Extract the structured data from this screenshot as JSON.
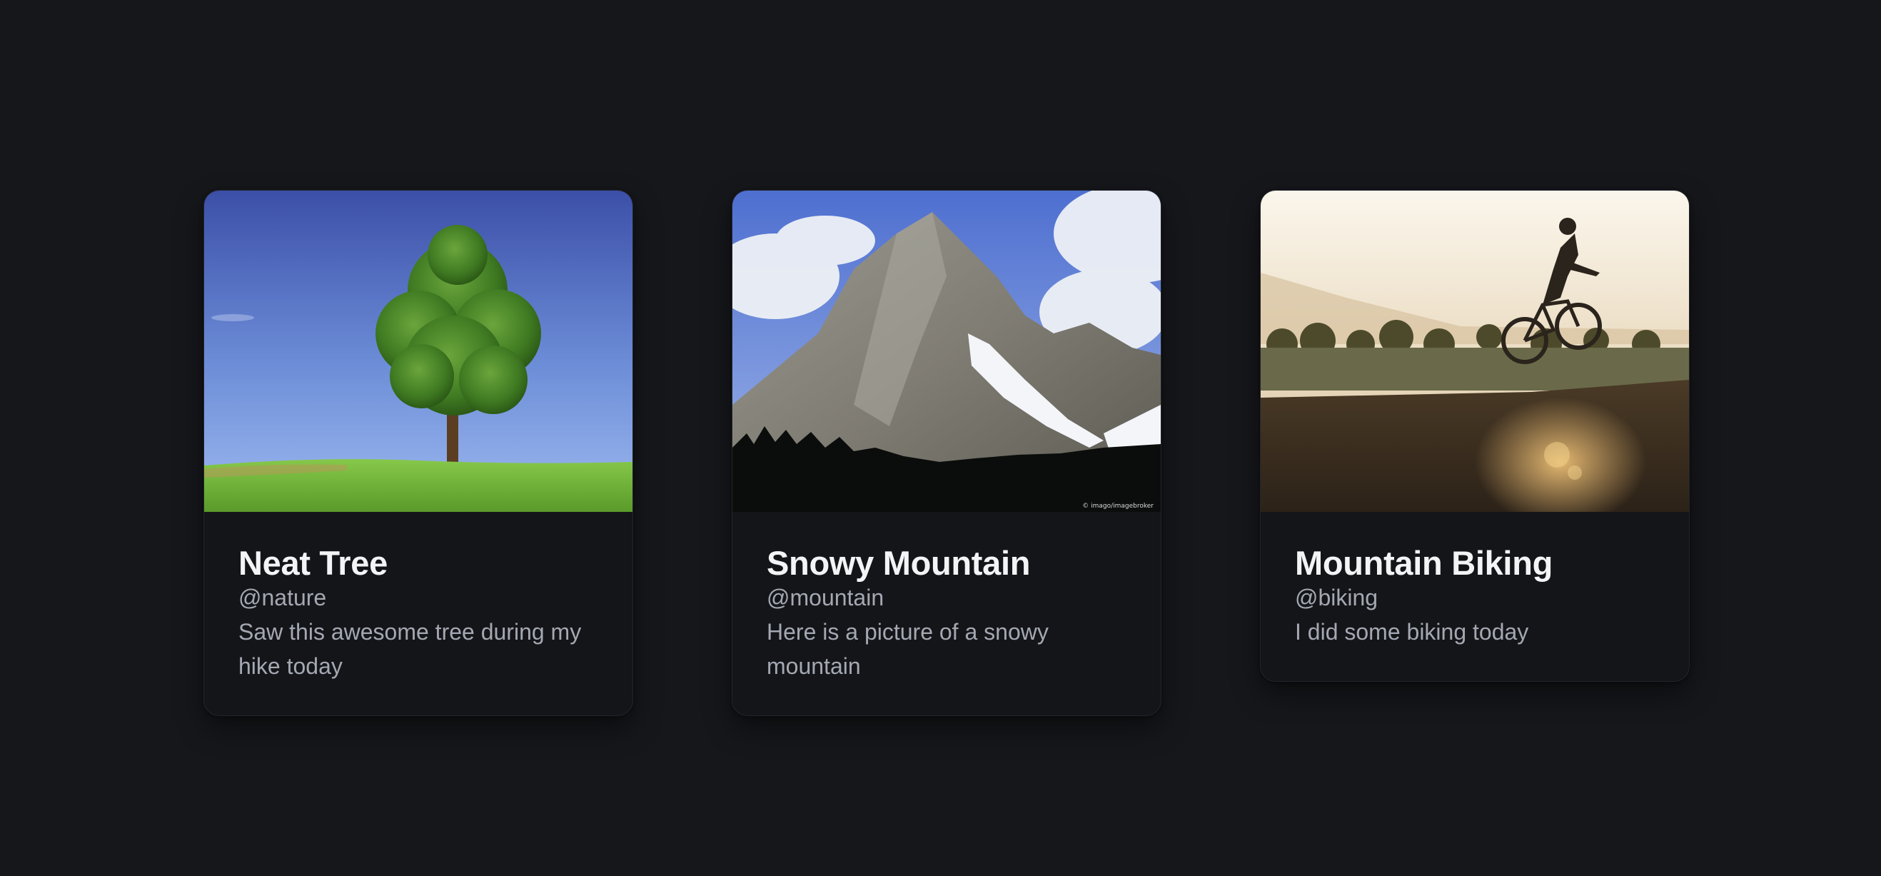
{
  "cards": [
    {
      "title": "Neat Tree",
      "handle": "@nature",
      "description": "Saw this awesome tree during my hike today",
      "image": "tree-photo"
    },
    {
      "title": "Snowy Mountain",
      "handle": "@mountain",
      "description": "Here is a picture of a snowy mountain",
      "image": "mountain-photo"
    },
    {
      "title": "Mountain Biking",
      "handle": "@biking",
      "description": "I did some biking today",
      "image": "biking-photo"
    }
  ],
  "colors": {
    "background": "#16171b",
    "card": "#141519",
    "title": "#f3f4f6",
    "muted": "#a4a8b2"
  }
}
